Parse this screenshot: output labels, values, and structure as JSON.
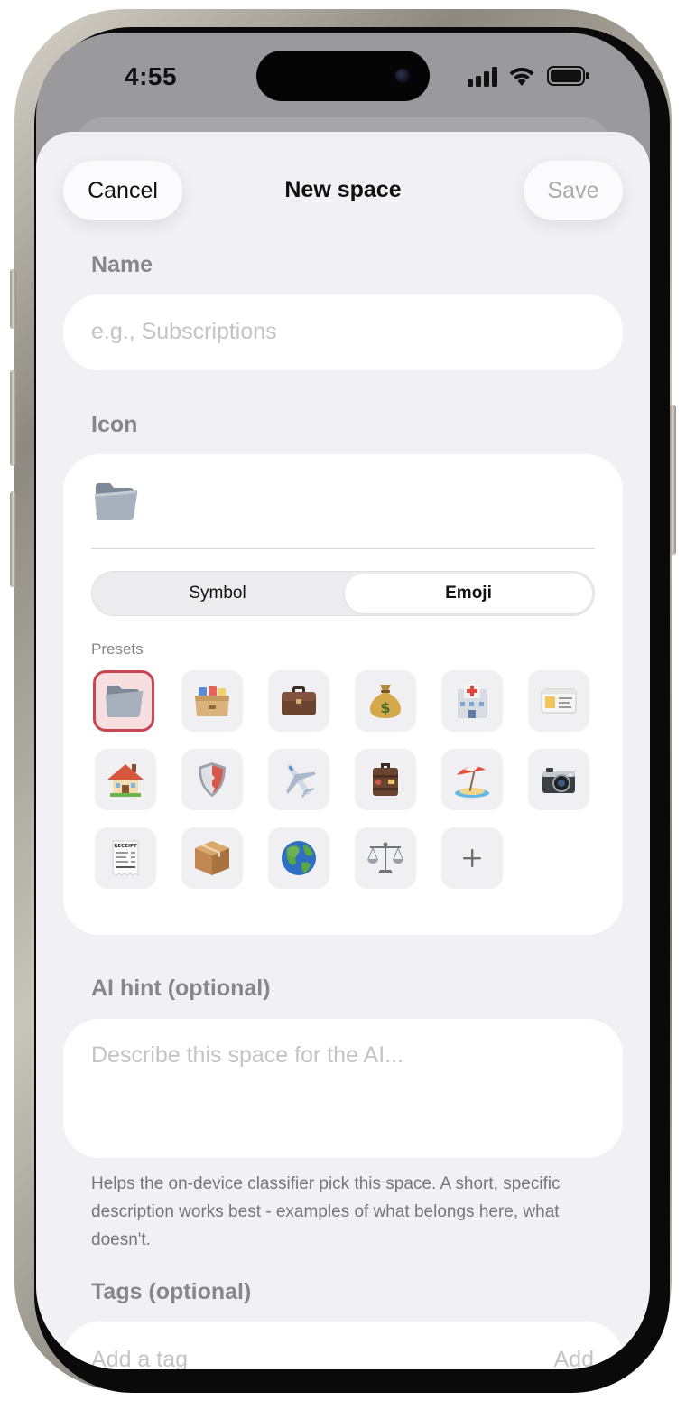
{
  "status_bar": {
    "time": "4:55",
    "icons": [
      "cellular-signal-icon",
      "wifi-icon",
      "battery-icon"
    ]
  },
  "header": {
    "cancel_label": "Cancel",
    "title": "New space",
    "save_label": "Save"
  },
  "name_section": {
    "label": "Name",
    "placeholder": "e.g., Subscriptions",
    "value": ""
  },
  "icon_section": {
    "label": "Icon",
    "current_icon": "file-folder-emoji",
    "segments": [
      {
        "label": "Symbol",
        "selected": false
      },
      {
        "label": "Emoji",
        "selected": true
      }
    ],
    "presets_label": "Presets",
    "presets": [
      {
        "icon": "file-folder-emoji",
        "selected": true
      },
      {
        "icon": "card-file-box-emoji",
        "selected": false
      },
      {
        "icon": "briefcase-emoji",
        "selected": false
      },
      {
        "icon": "money-bag-emoji",
        "selected": false
      },
      {
        "icon": "hospital-emoji",
        "selected": false
      },
      {
        "icon": "id-card-emoji",
        "selected": false
      },
      {
        "icon": "house-emoji",
        "selected": false
      },
      {
        "icon": "shield-emoji",
        "selected": false
      },
      {
        "icon": "airplane-emoji",
        "selected": false
      },
      {
        "icon": "luggage-emoji",
        "selected": false
      },
      {
        "icon": "beach-umbrella-emoji",
        "selected": false
      },
      {
        "icon": "camera-emoji",
        "selected": false
      },
      {
        "icon": "receipt-emoji",
        "selected": false
      },
      {
        "icon": "package-emoji",
        "selected": false
      },
      {
        "icon": "globe-emoji",
        "selected": false
      },
      {
        "icon": "balance-scale-emoji",
        "selected": false
      },
      {
        "icon": "plus-icon",
        "selected": false
      }
    ],
    "receipt_text": "RECEIPT"
  },
  "ai_hint_section": {
    "label": "AI hint (optional)",
    "placeholder": "Describe this space for the AI...",
    "value": "",
    "helper_text": "Helps the on-device classifier pick this space. A short, specific description works best - examples of what belongs here, what doesn't."
  },
  "tags_section": {
    "label": "Tags (optional)",
    "placeholder": "Add a tag",
    "add_label": "Add"
  },
  "colors": {
    "sheet_background": "#f1f1f5",
    "field_background": "#ffffff",
    "selected_preset_border": "#c64752",
    "selected_preset_fill": "#f7dfe0",
    "secondary_text": "#86868b",
    "placeholder_text": "#c4c4c8"
  }
}
